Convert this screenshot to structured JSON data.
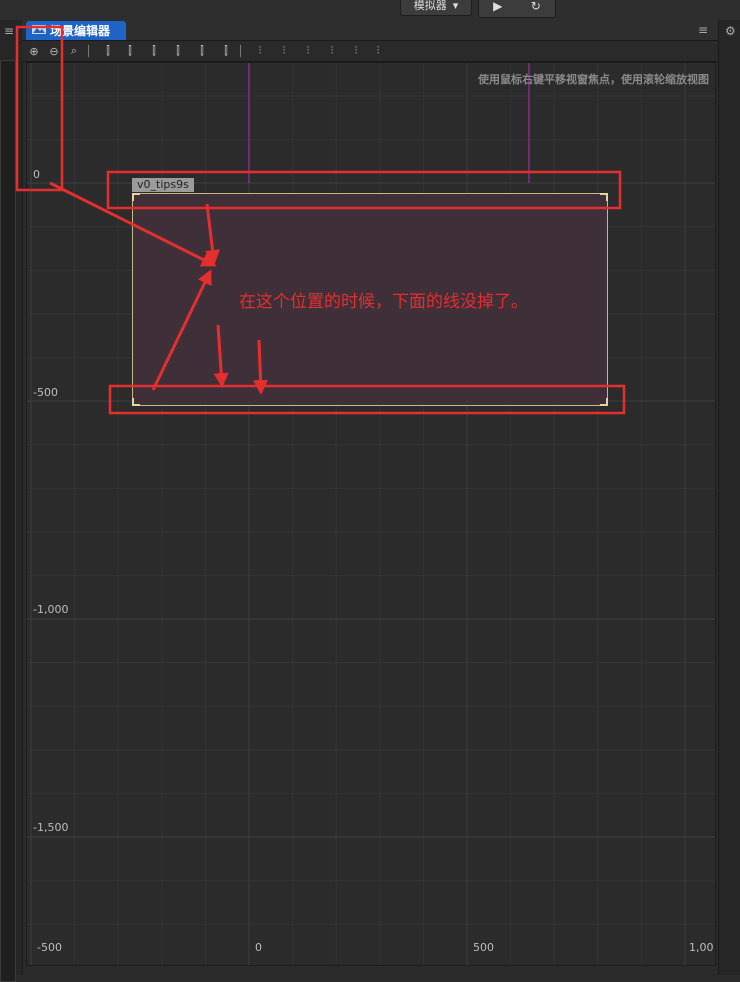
{
  "topbar": {
    "simulator_label": "模拟器",
    "dropdown_glyph": "▾",
    "play_glyph": "▶",
    "refresh_glyph": "↻"
  },
  "panels": {
    "menu_glyph": "≡",
    "gear_glyph": "⚙"
  },
  "tab": {
    "label": "场景编辑器"
  },
  "toolbar": {
    "tools": [
      {
        "name": "zoom-in-icon",
        "glyph": "⊕"
      },
      {
        "name": "zoom-out-icon",
        "glyph": "⊖"
      },
      {
        "name": "zoom-reset-icon",
        "glyph": "⌕"
      },
      {
        "name": "align-left-icon",
        "glyph": "⫿"
      },
      {
        "name": "align-hcenter-icon",
        "glyph": "⫿"
      },
      {
        "name": "align-right-icon",
        "glyph": "⫿"
      },
      {
        "name": "align-top-icon",
        "glyph": "⫿"
      },
      {
        "name": "align-vcenter-icon",
        "glyph": "⫿"
      },
      {
        "name": "align-bottom-icon",
        "glyph": "⫿"
      },
      {
        "name": "distribute-top-icon",
        "glyph": "⫶"
      },
      {
        "name": "distribute-vcenter-icon",
        "glyph": "⫶"
      },
      {
        "name": "distribute-bottom-icon",
        "glyph": "⫶"
      },
      {
        "name": "distribute-left-icon",
        "glyph": "⫶"
      },
      {
        "name": "distribute-hcenter-icon",
        "glyph": "⫶"
      },
      {
        "name": "distribute-right-icon",
        "glyph": "⫶"
      }
    ]
  },
  "viewport": {
    "hint": "使用鼠标右键平移视窗焦点，使用滚轮缩放视图",
    "y_labels": [
      "0",
      "-500",
      "-1,000",
      "-1,500"
    ],
    "x_labels": [
      "-500",
      "0",
      "500",
      "1,00"
    ]
  },
  "node": {
    "name": "v0_tips9s"
  },
  "annotation": {
    "text": "在这个位置的时候，下面的线没掉了。",
    "color": "#e52e2e"
  },
  "colors": {
    "accent": "#1e64c6",
    "node_fill": "#3f2f39",
    "node_border": "#c8b58a",
    "design_line": "#8a2a8a"
  }
}
